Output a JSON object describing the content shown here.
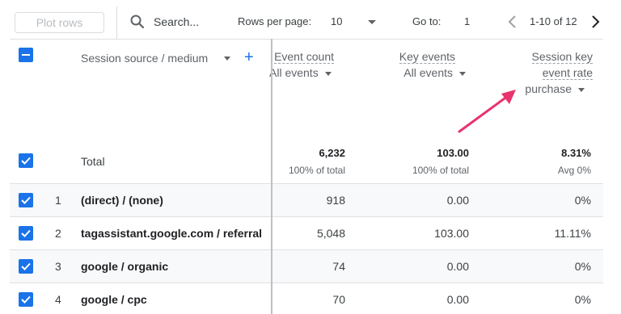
{
  "toolbar": {
    "plot_rows_label": "Plot rows",
    "search_placeholder": "Search...",
    "rows_per_page_label": "Rows per page:",
    "rows_per_page_value": "10",
    "go_to_label": "Go to:",
    "go_to_value": "1",
    "page_range": "1-10 of 12"
  },
  "table": {
    "dimension_header": "Session source / medium",
    "columns": [
      {
        "title": "Event count",
        "filter": "All events"
      },
      {
        "title": "Key events",
        "filter": "All events"
      },
      {
        "title_line1": "Session key",
        "title_line2": "event rate",
        "filter": "purchase"
      }
    ],
    "total": {
      "label": "Total",
      "values": [
        "6,232",
        "103.00",
        "8.31%"
      ],
      "subs": [
        "100% of total",
        "100% of total",
        "Avg 0%"
      ]
    },
    "rows": [
      {
        "num": "1",
        "dim": "(direct) / (none)",
        "values": [
          "918",
          "0.00",
          "0%"
        ]
      },
      {
        "num": "2",
        "dim": "tagassistant.google.com / referral",
        "values": [
          "5,048",
          "103.00",
          "11.11%"
        ]
      },
      {
        "num": "3",
        "dim": "google / organic",
        "values": [
          "74",
          "0.00",
          "0%"
        ]
      },
      {
        "num": "4",
        "dim": "google / cpc",
        "values": [
          "70",
          "0.00",
          "0%"
        ]
      }
    ]
  },
  "colors": {
    "accent": "#1a73e8",
    "annotation_arrow": "#e8336d"
  },
  "icons": [
    "search-icon",
    "chevron-left-icon",
    "chevron-right-icon",
    "caret-down-icon",
    "plus-icon",
    "checkbox-icon",
    "indeterminate-checkbox-icon",
    "annotation-arrow-icon"
  ]
}
